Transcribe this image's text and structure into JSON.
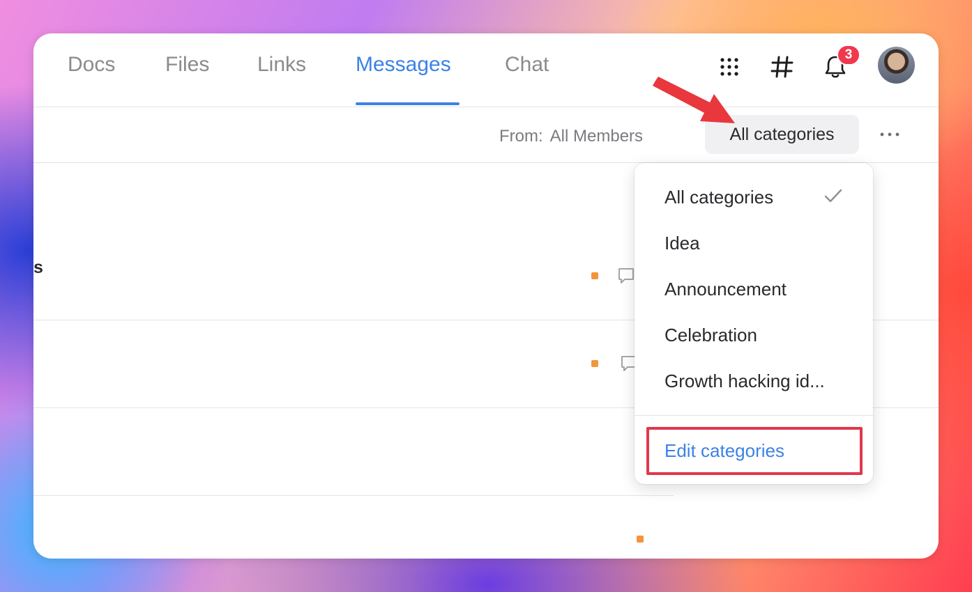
{
  "nav": {
    "tabs": [
      {
        "label": "Docs"
      },
      {
        "label": "Files"
      },
      {
        "label": "Links"
      },
      {
        "label": "Messages",
        "active": true
      },
      {
        "label": "Chat"
      }
    ],
    "notification_count": "3"
  },
  "filter": {
    "from_label": "From:",
    "from_value": "All Members",
    "category_button": "All categories"
  },
  "rows": [
    {
      "fragment": "s"
    }
  ],
  "dropdown": {
    "items": [
      {
        "label": "All categories",
        "selected": true
      },
      {
        "label": "Idea"
      },
      {
        "label": "Announcement"
      },
      {
        "label": "Celebration"
      },
      {
        "label": "Growth hacking id..."
      }
    ],
    "edit_label": "Edit categories"
  },
  "colors": {
    "accent": "#3b82e6",
    "badge": "#f0394e",
    "annotation": "#e0384a",
    "category_dot": "#f3953a"
  },
  "icons": [
    "apps-grid-icon",
    "hashtag-icon",
    "bell-icon",
    "more-horizontal-icon",
    "checkmark-icon",
    "comment-icon"
  ]
}
